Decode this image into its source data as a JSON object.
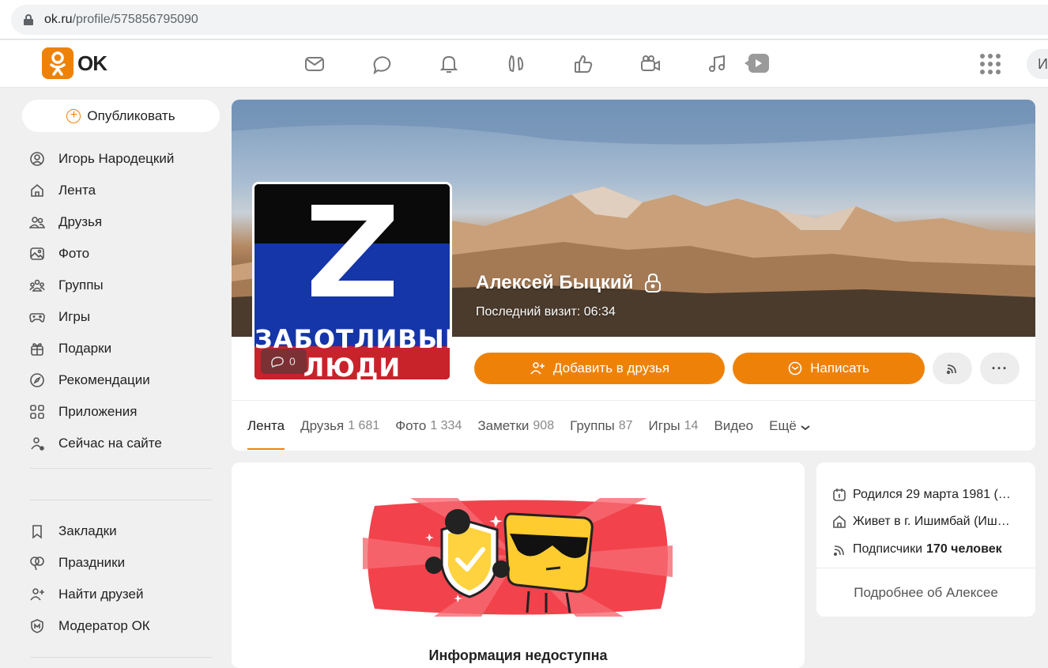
{
  "browser": {
    "url_domain": "ok.ru",
    "url_path": "/profile/575856795090"
  },
  "topnav": {
    "logo_text": "OK",
    "icons": [
      "mail-icon",
      "chat-icon",
      "bell-icon",
      "guests-icon",
      "like-icon",
      "video-camera-icon",
      "music-icon",
      "video-play-icon"
    ],
    "search_stub": "И"
  },
  "sidebar": {
    "publish_label": "Опубликовать",
    "items": [
      {
        "label": "Игорь Народецкий",
        "icon": "user-icon"
      },
      {
        "label": "Лента",
        "icon": "home-icon"
      },
      {
        "label": "Друзья",
        "icon": "friends-icon"
      },
      {
        "label": "Фото",
        "icon": "photo-icon"
      },
      {
        "label": "Группы",
        "icon": "groups-icon"
      },
      {
        "label": "Игры",
        "icon": "gamepad-icon"
      },
      {
        "label": "Подарки",
        "icon": "gift-icon"
      },
      {
        "label": "Рекомендации",
        "icon": "compass-icon"
      },
      {
        "label": "Приложения",
        "icon": "apps-icon"
      },
      {
        "label": "Сейчас на сайте",
        "icon": "online-user-icon"
      }
    ],
    "items2": [
      {
        "label": "Закладки",
        "icon": "bookmark-icon"
      },
      {
        "label": "Праздники",
        "icon": "balloons-icon"
      },
      {
        "label": "Найти друзей",
        "icon": "add-user-icon"
      },
      {
        "label": "Модератор ОК",
        "icon": "moderator-icon"
      }
    ]
  },
  "profile": {
    "avatar_text_line1": "ЗАБОТЛИВЫЕ",
    "avatar_text_line2": "ЛЮДИ",
    "avatar_comments": "0",
    "name": "Алексей Быцкий",
    "last_visit": "Последний визит: 06:34",
    "add_friend_label": "Добавить в друзья",
    "write_label": "Написать",
    "tabs": [
      {
        "label": "Лента",
        "count": ""
      },
      {
        "label": "Друзья",
        "count": "1 681"
      },
      {
        "label": "Фото",
        "count": "1 334"
      },
      {
        "label": "Заметки",
        "count": "908"
      },
      {
        "label": "Группы",
        "count": "87"
      },
      {
        "label": "Игры",
        "count": "14"
      },
      {
        "label": "Видео",
        "count": ""
      },
      {
        "label": "Ещё",
        "count": ""
      }
    ]
  },
  "main": {
    "info_title": "Информация недоступна"
  },
  "info": {
    "born": "Родился 29 марта 1981 (…",
    "lives": "Живет в г. Ишимбай (Иш…",
    "subscribers_label": "Подписчики",
    "subscribers_count": "170 человек",
    "more_label": "Подробнее об Алексее"
  },
  "colors": {
    "accent": "#ee8208",
    "background": "#f0f0f0"
  }
}
